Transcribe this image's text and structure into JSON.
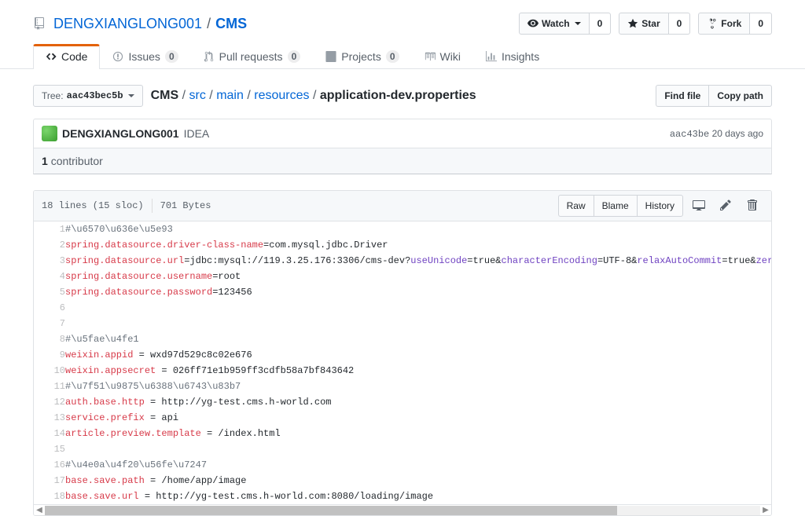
{
  "repo": {
    "owner": "DENGXIANGLONG001",
    "name": "CMS",
    "watch_label": "Watch",
    "watch_count": "0",
    "star_label": "Star",
    "star_count": "0",
    "fork_label": "Fork",
    "fork_count": "0"
  },
  "nav": {
    "code": "Code",
    "issues": "Issues",
    "issues_count": "0",
    "pulls": "Pull requests",
    "pulls_count": "0",
    "projects": "Projects",
    "projects_count": "0",
    "wiki": "Wiki",
    "insights": "Insights"
  },
  "branch": {
    "prefix": "Tree:",
    "sha": "aac43bec5b"
  },
  "breadcrumb": {
    "root": "CMS",
    "parts": [
      "src",
      "main",
      "resources"
    ],
    "file": "application-dev.properties",
    "sep": "/"
  },
  "filebtn": {
    "find": "Find file",
    "copy": "Copy path"
  },
  "commit": {
    "author": "DENGXIANGLONG001",
    "message": "IDEA",
    "sha": "aac43be",
    "age": "20 days ago"
  },
  "contributors": {
    "count": "1",
    "label": "contributor"
  },
  "fileinfo": {
    "lines": "18 lines (15 sloc)",
    "size": "701 Bytes"
  },
  "fileactions": {
    "raw": "Raw",
    "blame": "Blame",
    "history": "History"
  },
  "code_lines": [
    [
      {
        "c": "pl-c",
        "t": "#\\u6570\\u636e\\u5e93"
      }
    ],
    [
      {
        "c": "pl-k",
        "t": "spring.datasource.driver-class-name"
      },
      {
        "c": "",
        "t": "=com.mysql.jdbc.Driver"
      }
    ],
    [
      {
        "c": "pl-k",
        "t": "spring.datasource.url"
      },
      {
        "c": "",
        "t": "=jdbc:mysql://119.3.25.176:3306/cms-dev?"
      },
      {
        "c": "pl-e",
        "t": "useUnicode"
      },
      {
        "c": "",
        "t": "=true&"
      },
      {
        "c": "pl-e",
        "t": "characterEncoding"
      },
      {
        "c": "",
        "t": "=UTF-8&"
      },
      {
        "c": "pl-e",
        "t": "relaxAutoCommit"
      },
      {
        "c": "",
        "t": "=true&"
      },
      {
        "c": "pl-e",
        "t": "zeroDateTimeBeha"
      }
    ],
    [
      {
        "c": "pl-k",
        "t": "spring.datasource.username"
      },
      {
        "c": "",
        "t": "=root"
      }
    ],
    [
      {
        "c": "pl-k",
        "t": "spring.datasource.password"
      },
      {
        "c": "",
        "t": "=123456"
      }
    ],
    [],
    [],
    [
      {
        "c": "pl-c",
        "t": "#\\u5fae\\u4fe1"
      }
    ],
    [
      {
        "c": "pl-k",
        "t": "weixin.appid"
      },
      {
        "c": "",
        "t": " = wxd97d529c8c02e676"
      }
    ],
    [
      {
        "c": "pl-k",
        "t": "weixin.appsecret"
      },
      {
        "c": "",
        "t": " = 026ff71e1b959ff3cdfb58a7bf843642"
      }
    ],
    [
      {
        "c": "pl-c",
        "t": "#\\u7f51\\u9875\\u6388\\u6743\\u83b7"
      }
    ],
    [
      {
        "c": "pl-k",
        "t": "auth.base.http"
      },
      {
        "c": "",
        "t": " = http://yg-test.cms.h-world.com"
      }
    ],
    [
      {
        "c": "pl-k",
        "t": "service.prefix"
      },
      {
        "c": "",
        "t": " = api"
      }
    ],
    [
      {
        "c": "pl-k",
        "t": "article.preview.template"
      },
      {
        "c": "",
        "t": " = /index.html"
      }
    ],
    [],
    [
      {
        "c": "pl-c",
        "t": "#\\u4e0a\\u4f20\\u56fe\\u7247"
      }
    ],
    [
      {
        "c": "pl-k",
        "t": "base.save.path"
      },
      {
        "c": "",
        "t": " = /home/app/image"
      }
    ],
    [
      {
        "c": "pl-k",
        "t": "base.save.url"
      },
      {
        "c": "",
        "t": " = http://yg-test.cms.h-world.com:8080/loading/image"
      }
    ]
  ]
}
